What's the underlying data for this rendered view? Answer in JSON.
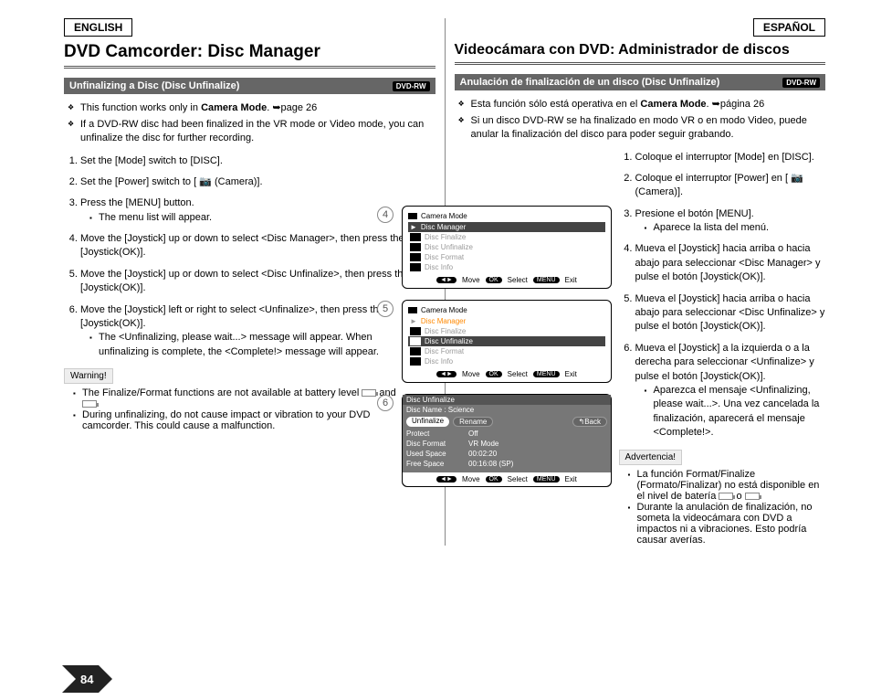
{
  "en": {
    "langTab": "ENGLISH",
    "title": "DVD Camcorder: Disc Manager",
    "subhead": "Unfinalizing a Disc (Disc Unfinalize)",
    "badge": "DVD-RW",
    "b1a": "This function works only in ",
    "b1b": "Camera Mode",
    "b1c": ". ➥page 26",
    "b2": "If a DVD-RW disc had been finalized in the VR mode or Video mode, you can unfinalize the disc for further recording.",
    "s1": "Set the [Mode] switch to [DISC].",
    "s2": "Set the [Power] switch to [ 📷 (Camera)].",
    "s3a": "Press the [MENU] button.",
    "s3b": "The menu list will appear.",
    "s4": "Move the [Joystick] up or down to select <Disc Manager>, then press the [Joystick(OK)].",
    "s5": "Move the [Joystick] up or down to select <Disc Unfinalize>, then press the [Joystick(OK)].",
    "s6a": "Move the [Joystick] left or right to select <Unfinalize>, then press the [Joystick(OK)].",
    "s6b": "The <Unfinalizing, please wait...> message will appear. When unfinalizing is complete, the <Complete!> message will appear.",
    "warnLabel": "Warning!",
    "w1a": "The Finalize/Format functions are not available at battery level ",
    "w1b": " and ",
    "w1c": ".",
    "w2": "During unfinalizing, do not cause impact or vibration to your DVD camcorder. This could cause a malfunction."
  },
  "es": {
    "langTab": "ESPAÑOL",
    "title": "Videocámara con DVD: Administrador de discos",
    "subhead": "Anulación de finalización de un disco (Disc Unfinalize)",
    "badge": "DVD-RW",
    "b1a": "Esta función sólo está operativa en el ",
    "b1b": "Camera Mode",
    "b1c": ". ➥página 26",
    "b2": "Si un disco DVD-RW se ha finalizado en modo VR o en modo Video, puede anular la finalización del disco para poder seguir grabando.",
    "s1": "Coloque el interruptor [Mode] en [DISC].",
    "s2": "Coloque el interruptor [Power] en [ 📷 (Camera)].",
    "s3a": "Presione el botón [MENU].",
    "s3b": "Aparece la lista del menú.",
    "s4": "Mueva el [Joystick] hacia arriba o hacia abajo para seleccionar <Disc Manager> y pulse el botón [Joystick(OK)].",
    "s5": "Mueva el [Joystick] hacia arriba o hacia abajo para seleccionar <Disc Unfinalize> y pulse el botón [Joystick(OK)].",
    "s6a": "Mueva el [Joystick] a la izquierda o a la derecha para seleccionar <Unfinalize> y pulse el botón [Joystick(OK)].",
    "s6b": "Aparezca el mensaje <Unfinalizing, please wait...>. Una vez cancelada la finalización, aparecerá el mensaje <Complete!>.",
    "warnLabel": "Advertencia!",
    "w1a": "La función Format/Finalize (Formato/Finalizar) no está disponible en el nivel de batería ",
    "w1b": " o ",
    "w1c": ".",
    "w2": "Durante la anulación de finalización, no someta la videocámara con DVD a impactos ni a vibraciones. Esto podría causar averías."
  },
  "menu": {
    "cameraMode": "Camera Mode",
    "discManager": "Disc Manager",
    "discFinalize": "Disc Finalize",
    "discUnfinalize": "Disc Unfinalize",
    "discFormat": "Disc Format",
    "discInfo": "Disc Info",
    "move": "Move",
    "select": "Select",
    "exit": "Exit",
    "ok": "OK",
    "menuBtn": "MENU",
    "discName": "Disc Name : Science",
    "unfinalize": "Unfinalize",
    "rename": "Rename",
    "back": "Back",
    "protect": "Protect",
    "protectVal": "Off",
    "formatVal": "VR Mode",
    "usedSpace": "Used Space",
    "usedVal": "00:02:20",
    "freeSpace": "Free Space",
    "freeVal": "00:16:08 (SP)"
  },
  "pageNum": "84"
}
